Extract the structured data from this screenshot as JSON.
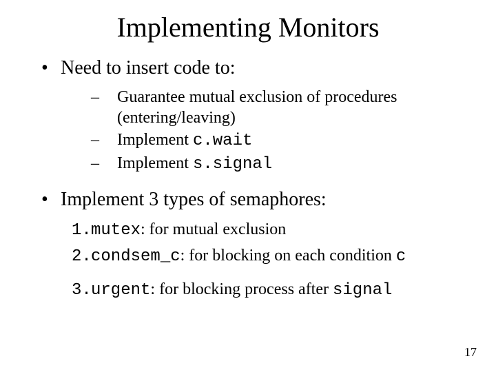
{
  "title": "Implementing Monitors",
  "point1": {
    "text": "Need to insert code to:",
    "subs": [
      {
        "pre": "Guarantee mutual exclusion of procedures (entering/leaving)"
      },
      {
        "pre": "Implement ",
        "code": "c.wait"
      },
      {
        "pre": "Implement ",
        "code": "s.signal"
      }
    ]
  },
  "point2": {
    "text": "Implement 3 types of semaphores:",
    "items": [
      {
        "num": "1.",
        "code": "mutex",
        "rest": ": for mutual exclusion"
      },
      {
        "num": "2.",
        "code": "condsem_c",
        "rest": ": for blocking on each condition ",
        "tailcode": "c"
      },
      {
        "num": "3.",
        "code": "urgent",
        "rest": ": for blocking process after ",
        "tailcode": "signal"
      }
    ]
  },
  "page": "17"
}
